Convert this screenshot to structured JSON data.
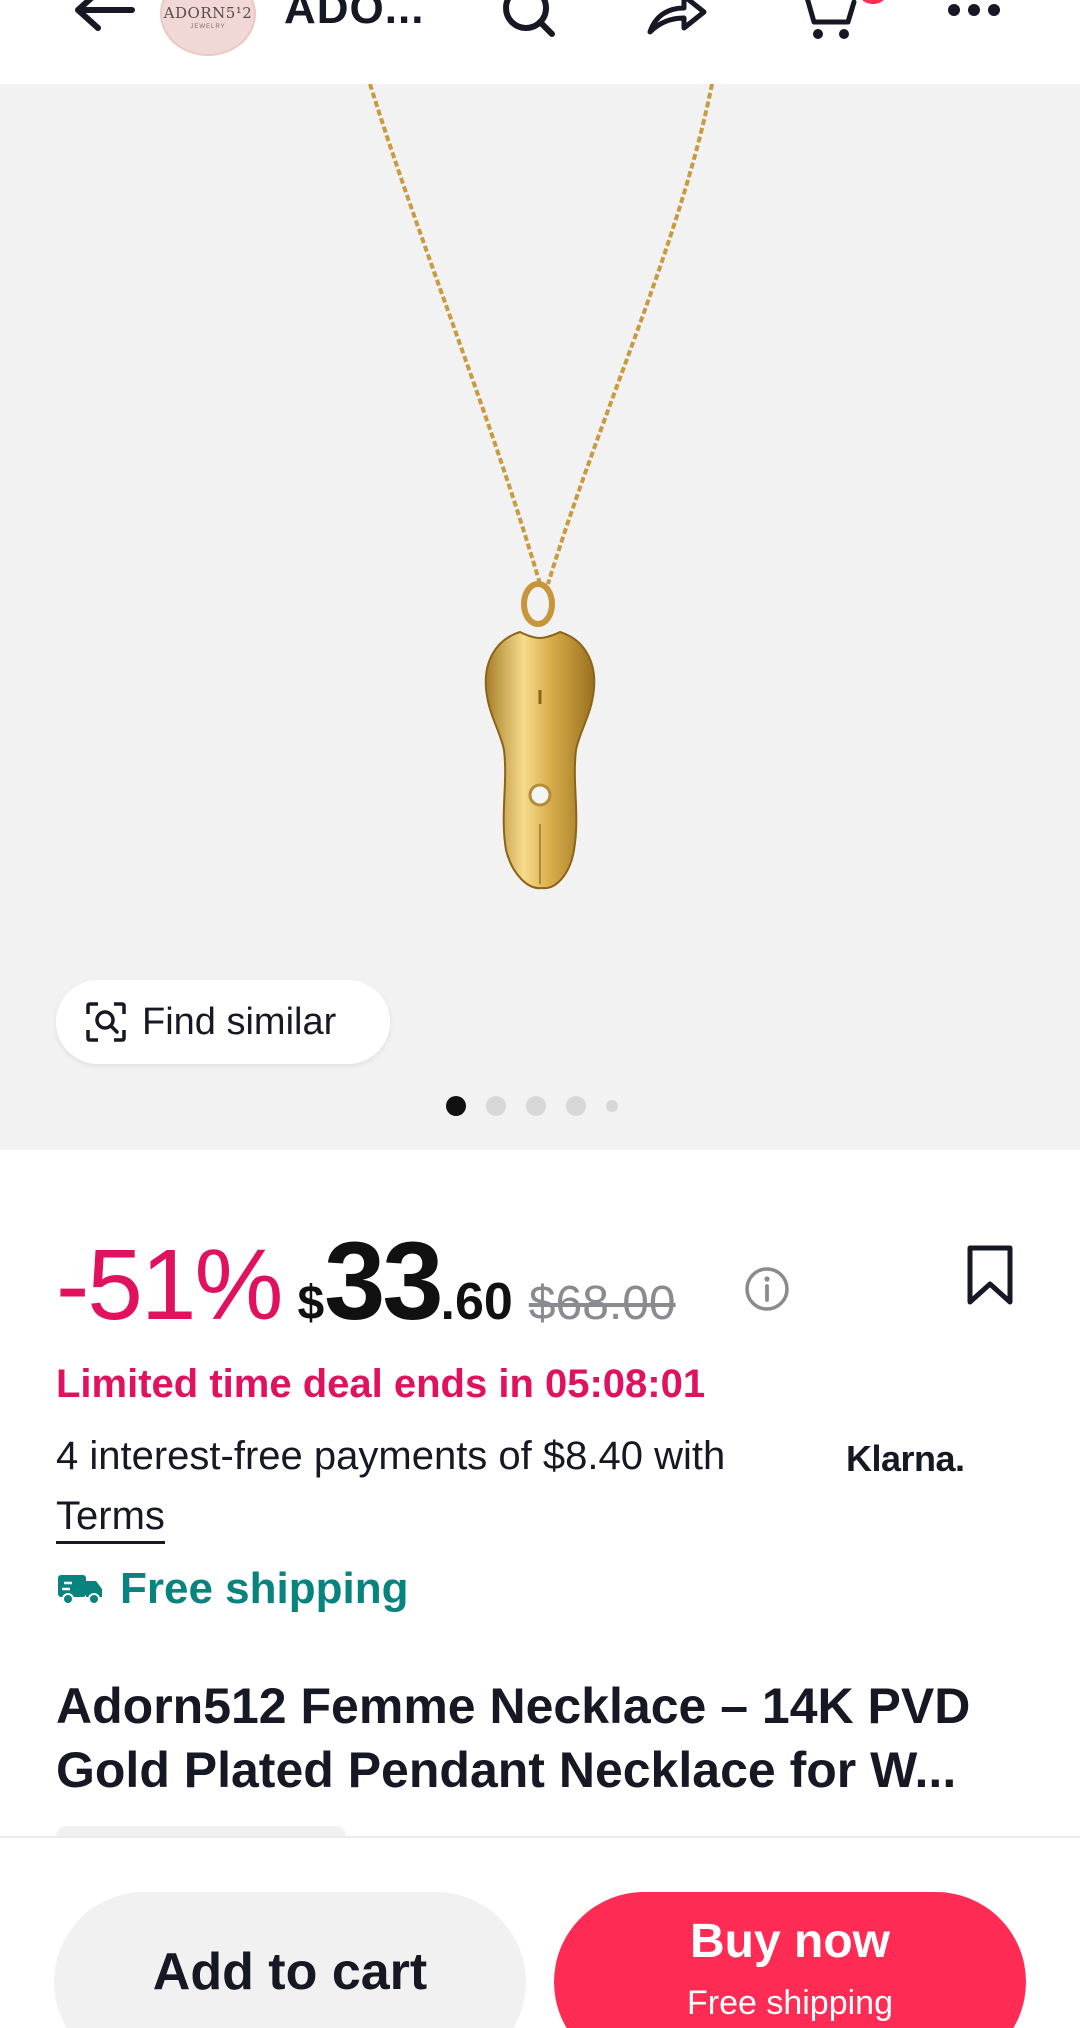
{
  "header": {
    "store_logo_text": "ADORN5¹2",
    "store_logo_sub": "JEWELRY",
    "store_name": "ADO..."
  },
  "product_image": {
    "find_similar_label": "Find similar",
    "carousel_total": 5,
    "carousel_active": 1
  },
  "price": {
    "discount": "-51%",
    "currency": "$",
    "main": "33",
    "cents": ".60",
    "original": "$68.00"
  },
  "deal": {
    "text": "Limited time deal ends in 05:08:01"
  },
  "payments": {
    "text": "4 interest-free payments of $8.40 with",
    "provider": "Klarna.",
    "terms_label": "Terms"
  },
  "shipping": {
    "label": "Free shipping"
  },
  "product": {
    "title_line1": "Adorn512 Femme Necklace – 14K PVD",
    "title_line2": "Gold Plated Pendant Necklace for W..."
  },
  "actions": {
    "add_to_cart": "Add to cart",
    "buy_now": "Buy now",
    "buy_now_sub": "Free shipping"
  },
  "colors": {
    "accent_red": "#fe2c55",
    "discount_pink": "#e0115f",
    "shipping_teal": "#08837e"
  },
  "icons": [
    "back-arrow-icon",
    "search-icon",
    "share-icon",
    "cart-icon",
    "more-icon",
    "find-similar-icon",
    "info-icon",
    "bookmark-icon",
    "truck-icon"
  ]
}
